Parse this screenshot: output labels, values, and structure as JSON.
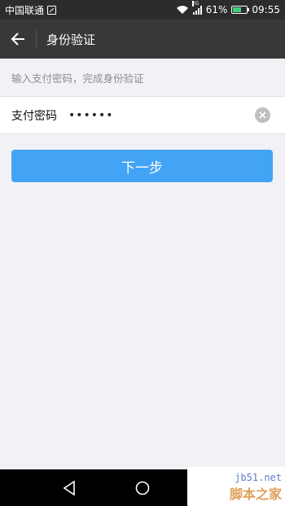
{
  "status_bar": {
    "carrier": "中国联通",
    "network_type": "2G",
    "battery_level": "61%",
    "battery_fraction": 0.61,
    "time": "09:55"
  },
  "header": {
    "title": "身份验证",
    "back_icon": "arrow-left-icon"
  },
  "hint": {
    "text": "输入支付密码，完成身份验证"
  },
  "password_field": {
    "label": "支付密码",
    "value": "••••••",
    "clear_icon": "clear-icon"
  },
  "next_button": {
    "label": "下一步",
    "color": "#43a4f5"
  },
  "nav_bar": {
    "back_icon": "triangle-back-icon",
    "home_icon": "circle-home-icon",
    "recents_icon": "square-recents-icon"
  },
  "watermark": {
    "site": "jb51.net",
    "name": "脚本之家"
  }
}
